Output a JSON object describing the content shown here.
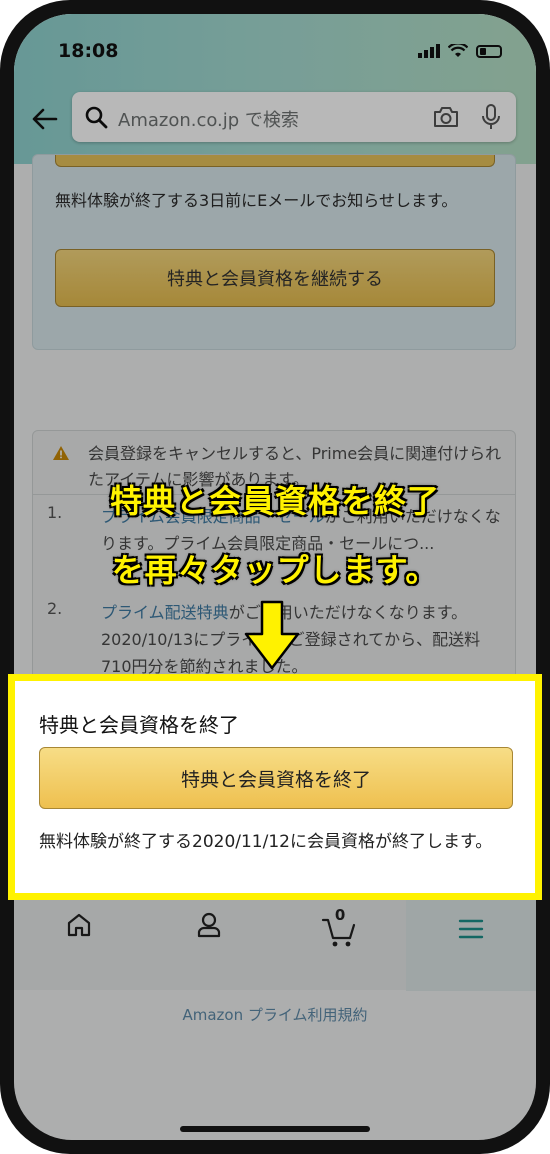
{
  "status_bar": {
    "time": "18:08"
  },
  "search": {
    "placeholder": "Amazon.co.jp で検索"
  },
  "card1": {
    "notice": "無料体験が終了する3日前にEメールでお知らせします。",
    "continue_button": "特典と会員資格を継続する"
  },
  "card2": {
    "warning": "会員登録をキャンセルすると、Prime会員に関連付けられたアイテムに影響があります。",
    "items": [
      {
        "number": "1.",
        "link": "プライム会員限定商品・セール",
        "text": "がご利用いただけなくなります。プライム会員限定商品・セールにつ..."
      },
      {
        "number": "2.",
        "link": "プライム配送特典",
        "text": "がご利用いただけなくなります。2020/10/13にプライムにご登録されてから、配送料710円分を節約されました。"
      }
    ]
  },
  "footer": {
    "terms_link": "Amazon プライム利用規約"
  },
  "tabbar": {
    "cart_count": "0"
  },
  "highlight": {
    "title": "特典と会員資格を終了",
    "button": "特典と会員資格を終了",
    "note": "無料体験が終了する2020/11/12に会員資格が終了します。"
  },
  "annotation": {
    "line1": "特典と会員資格を終了",
    "line2": "を再々タップします。",
    "color": "#fff200"
  }
}
